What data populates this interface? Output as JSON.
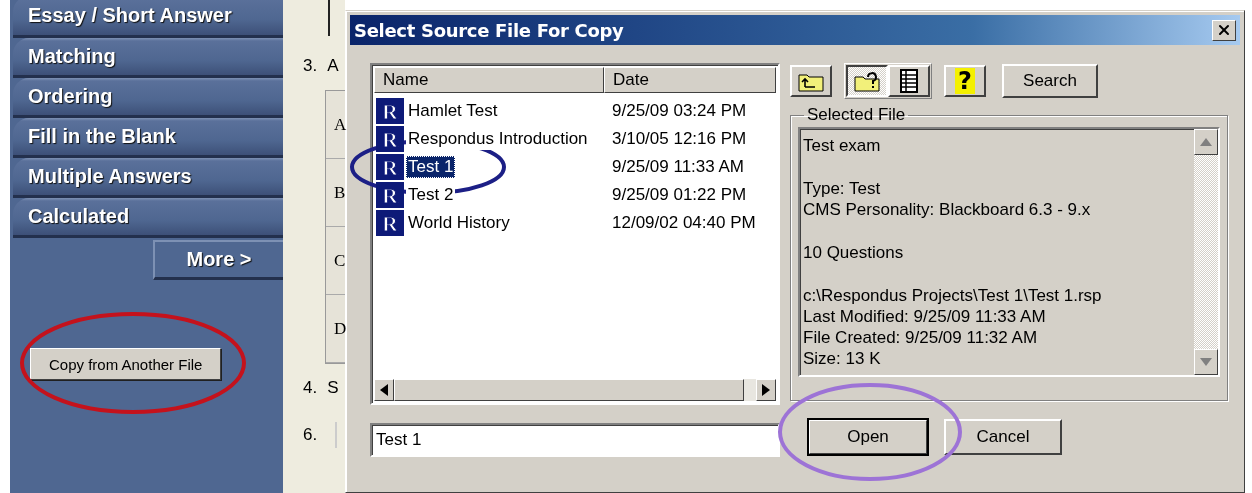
{
  "sidebar": {
    "items": [
      {
        "label": "Essay / Short Answer"
      },
      {
        "label": "Matching"
      },
      {
        "label": "Ordering"
      },
      {
        "label": "Fill in the Blank"
      },
      {
        "label": "Multiple Answers"
      },
      {
        "label": "Calculated"
      }
    ],
    "more_button": "More >",
    "copy_button": {
      "label": "Copy from Another File",
      "highlight": {
        "color": "#c4121c"
      }
    }
  },
  "background_page": {
    "question_3": {
      "number": "3.",
      "text": "A"
    },
    "choices": [
      "A",
      "B",
      "C",
      "D"
    ],
    "question_4": {
      "number": "4.",
      "text": "S"
    },
    "question_6": {
      "number": "6."
    }
  },
  "dialog": {
    "title": "Select Source File For Copy",
    "file_list": {
      "columns": [
        "Name",
        "Date"
      ],
      "rows": [
        {
          "icon": "R",
          "name": "Hamlet Test",
          "date": "9/25/09  03:24 PM",
          "selected": false
        },
        {
          "icon": "R",
          "name": "Respondus Introduction",
          "date": "3/10/05  12:16 PM",
          "selected": false
        },
        {
          "icon": "R",
          "name": "Test 1",
          "date": "9/25/09  11:33 AM",
          "selected": true,
          "highlight": {
            "color": "#1c1f86"
          }
        },
        {
          "icon": "R",
          "name": "Test 2",
          "date": "9/25/09  01:22 PM",
          "selected": false
        },
        {
          "icon": "R",
          "name": "World History",
          "date": "12/09/02  04:40 PM",
          "selected": false
        }
      ]
    },
    "file_name_field": {
      "value": "Test 1"
    },
    "toolbar": {
      "buttons": [
        {
          "kind": "up-folder",
          "pressed": false
        },
        {
          "kind": "preview",
          "pressed": true
        },
        {
          "kind": "details",
          "pressed": false
        },
        {
          "kind": "help",
          "label": "?",
          "pressed": false
        }
      ],
      "search": "Search"
    },
    "selected_file": {
      "legend": "Selected File",
      "paragraphs": [
        {
          "lines": [
            "Test exam"
          ]
        },
        {
          "lines": [
            "Type: Test",
            "CMS Personality: Blackboard  6.3 - 9.x"
          ]
        },
        {
          "lines": [
            "10 Questions"
          ]
        },
        {
          "lines": [
            "c:\\Respondus Projects\\Test 1\\Test 1.rsp",
            "Last Modified: 9/25/09  11:33 AM",
            "File Created: 9/25/09  11:32 AM",
            "Size: 13 K"
          ]
        }
      ]
    },
    "open_button": {
      "label": "Open",
      "default": true,
      "highlight": {
        "color": "#9d73d6"
      }
    },
    "cancel_button": {
      "label": "Cancel",
      "default": false
    }
  }
}
